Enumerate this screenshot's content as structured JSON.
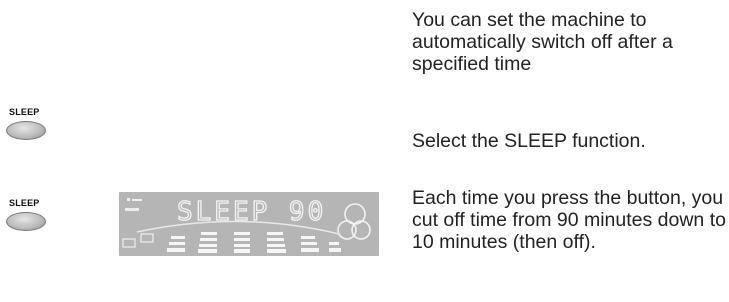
{
  "steps": [
    {
      "text": "You can set the machine to automatically switch off after a specified time"
    },
    {
      "button_label": "SLEEP",
      "text": "Select the SLEEP function."
    },
    {
      "button_label": "SLEEP",
      "text": "Each time you press the button, you cut off time from 90 minutes down to 10 minutes (then off).",
      "display": {
        "segment_text": "SLEEP 90",
        "color_lcd": "#b5b5b5",
        "color_segments": "#f4f4f4"
      }
    }
  ]
}
